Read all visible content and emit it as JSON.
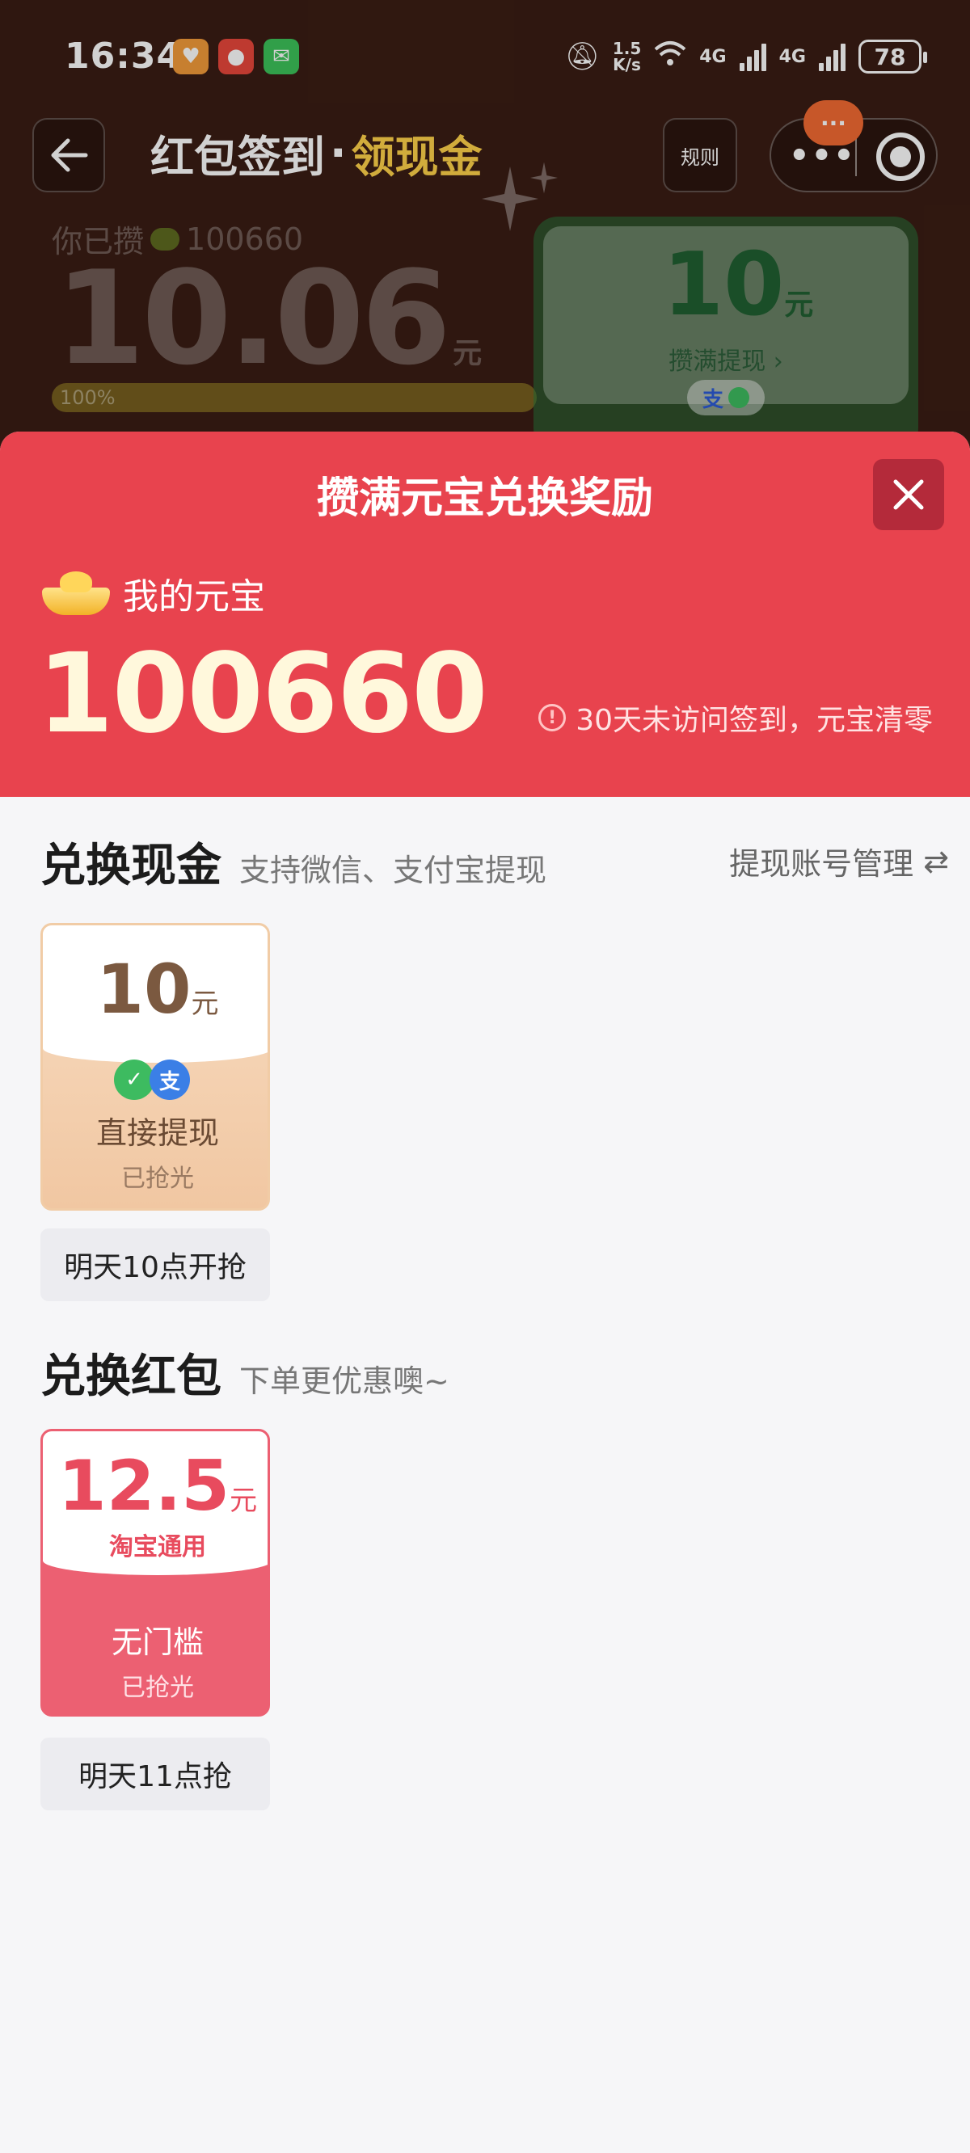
{
  "status_bar": {
    "time": "16:34",
    "net_speed_value": "1.5",
    "net_speed_unit": "K/s",
    "network_1": "4G",
    "network_2": "4G",
    "battery": "78"
  },
  "nav": {
    "title_main": "红包签到",
    "title_dot": "·",
    "title_accent": "领现金",
    "rules_label": "规则",
    "notification_dots": "···"
  },
  "background_summary": {
    "saved_prefix": "你已攒",
    "saved_points": "100660",
    "amount": "10.06",
    "amount_unit": "元",
    "progress_text": "100%",
    "progress_value": 1.0,
    "card_amount": "10",
    "card_unit": "元",
    "card_cta": "攒满提现 ›",
    "card_pay_icon": "支"
  },
  "sheet": {
    "title": "攒满元宝兑换奖励",
    "my_label": "我的元宝",
    "yuanbao_value": "100660",
    "expire_icon": "!",
    "expire_note": "30天未访问签到，元宝清零"
  },
  "cash_section": {
    "title": "兑换现金",
    "subtitle": "支持微信、支付宝提现",
    "account_link": "提现账号管理",
    "account_icon": "⇄",
    "card": {
      "amount": "10",
      "unit": "元",
      "wechat_icon": "✓",
      "alipay_icon": "支",
      "label": "直接提现",
      "status": "已抢光"
    },
    "time_chip": "明天10点开抢"
  },
  "redpacket_section": {
    "title": "兑换红包",
    "subtitle": "下单更优惠噢~",
    "card": {
      "amount": "12.5",
      "unit": "元",
      "scope": "淘宝通用",
      "label": "无门槛",
      "status": "已抢光"
    },
    "time_chip": "明天11点抢"
  },
  "colors": {
    "header_red": "#e8434e",
    "accent_yellow": "#ffd24a",
    "coupon_red": "#ec6072"
  }
}
